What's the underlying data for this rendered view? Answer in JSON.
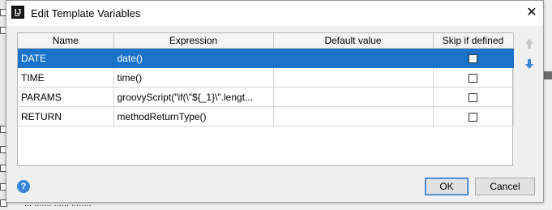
{
  "window": {
    "title": "Edit Template Variables",
    "close_label": "✕"
  },
  "table": {
    "columns": [
      "Name",
      "Expression",
      "Default value",
      "Skip if defined"
    ],
    "rows": [
      {
        "name": "DATE",
        "expression": "date()",
        "default": "",
        "skip": false,
        "selected": true
      },
      {
        "name": "TIME",
        "expression": "time()",
        "default": "",
        "skip": false,
        "selected": false
      },
      {
        "name": "PARAMS",
        "expression": "groovyScript(\"if(\\\"${_1}\\\".lengt...",
        "default": "",
        "skip": false,
        "selected": false
      },
      {
        "name": "RETURN",
        "expression": "methodReturnType()",
        "default": "",
        "skip": false,
        "selected": false
      }
    ]
  },
  "side_controls": {
    "up_icon": "arrow-up-icon",
    "down_icon": "arrow-down-icon"
  },
  "footer": {
    "help_label": "?",
    "ok_label": "OK",
    "cancel_label": "Cancel"
  },
  "background": {
    "partial_text": "... ....... ...... ........"
  },
  "colors": {
    "selection": "#1a73c9",
    "accent": "#3a86d6"
  }
}
